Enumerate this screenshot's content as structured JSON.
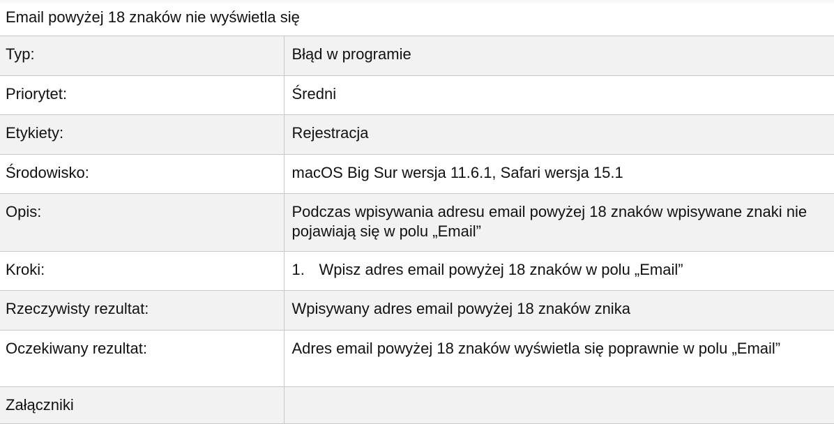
{
  "title": "Email powyżej 18 znaków nie wyświetla się",
  "rows": [
    {
      "label": "Typ:",
      "value": "Błąd w programie"
    },
    {
      "label": "Priorytet:",
      "value": "Średni"
    },
    {
      "label": "Etykiety:",
      "value": "Rejestracja"
    },
    {
      "label": "Środowisko:",
      "value": "macOS Big Sur wersja 11.6.1, Safari wersja 15.1"
    },
    {
      "label": "Opis:",
      "value": "Podczas wpisywania adresu email powyżej 18 znaków wpisywane znaki nie pojawiają się w polu „Email”"
    },
    {
      "label": "Kroki:",
      "steps": [
        {
          "num": "1.",
          "text": "Wpisz adres email powyżej 18 znaków w polu „Email”"
        }
      ]
    },
    {
      "label": "Rzeczywisty rezultat:",
      "value": "Wpisywany adres email powyżej 18 znaków znika"
    },
    {
      "label": "Oczekiwany rezultat:",
      "value": "Adres email powyżej 18 znaków wyświetla się poprawnie w polu „Email”"
    },
    {
      "label": "Załączniki",
      "value": ""
    }
  ]
}
